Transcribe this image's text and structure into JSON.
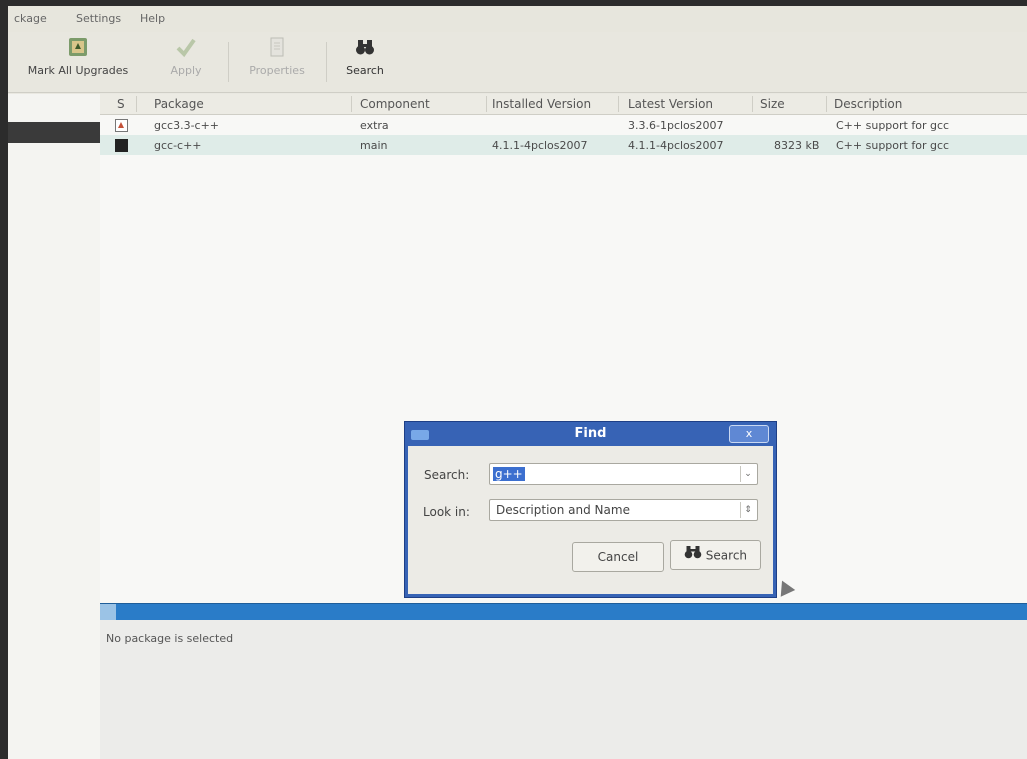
{
  "menu": [
    "ckage",
    "Settings",
    "Help"
  ],
  "toolbar": {
    "mark_all": "Mark All Upgrades",
    "apply": "Apply",
    "properties": "Properties",
    "search": "Search"
  },
  "table": {
    "columns": [
      "S",
      "Package",
      "Component",
      "Installed Version",
      "Latest Version",
      "Size",
      "Description"
    ],
    "rows": [
      {
        "package": "gcc3.3-c++",
        "component": "extra",
        "installed": "",
        "latest": "3.3.6-1pclos2007",
        "size": "",
        "description": "C++ support for gcc"
      },
      {
        "package": "gcc-c++",
        "component": "main",
        "installed": "4.1.1-4pclos2007",
        "latest": "4.1.1-4pclos2007",
        "size": "8323 kB",
        "description": "C++ support for gcc"
      }
    ]
  },
  "details": {
    "text": "No package is selected"
  },
  "find_dialog": {
    "title": "Find",
    "close": "x",
    "search_label": "Search:",
    "search_value": "g++",
    "look_in_label": "Look in:",
    "look_in_value": "Description and Name",
    "cancel": "Cancel",
    "search_button": "Search"
  },
  "colors": {
    "dialog_frame": "#3763b5",
    "selection": "#3c6fcf",
    "status_bar": "#2a7cc8",
    "row_highlight": "#dfece8"
  }
}
